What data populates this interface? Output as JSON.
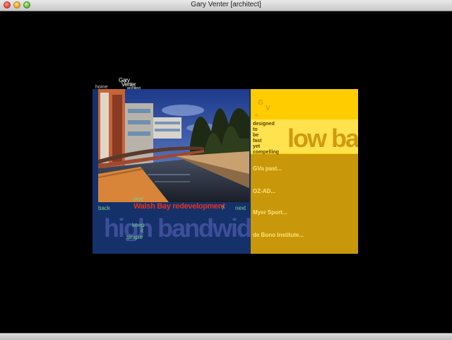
{
  "window": {
    "title": "Gary Venter [architect]"
  },
  "header": {
    "home_label": "home",
    "logo": {
      "line1": "Gary",
      "line2": "Venter",
      "line3": "architect"
    }
  },
  "project": {
    "title": "Walsh Bay redevelopment",
    "nav": {
      "back": "back",
      "next_top": "next",
      "help": "?",
      "next": "next"
    }
  },
  "left_panel": {
    "headline": "high bandwidth",
    "motto": [
      "keep",
      "it",
      "simple"
    ]
  },
  "right_panel": {
    "monogram": {
      "g": "G",
      "v": "V",
      "a": "a"
    },
    "tagline": [
      "designed",
      "to",
      "be",
      "fast",
      "yet",
      "compelling"
    ],
    "headline": "low bandwidth",
    "menu": [
      {
        "label": "GVa past..."
      },
      {
        "label": "OZ-AD..."
      },
      {
        "label": "Myer Sport..."
      },
      {
        "label": "de Bono Institute..."
      }
    ]
  },
  "colors": {
    "background": "#000000",
    "left_panel": "#14316a",
    "right_panel_dark": "#c8980a",
    "right_panel_light": "#ffcc00",
    "title_red": "#e8301d",
    "nav_green": "#7fd08a"
  }
}
